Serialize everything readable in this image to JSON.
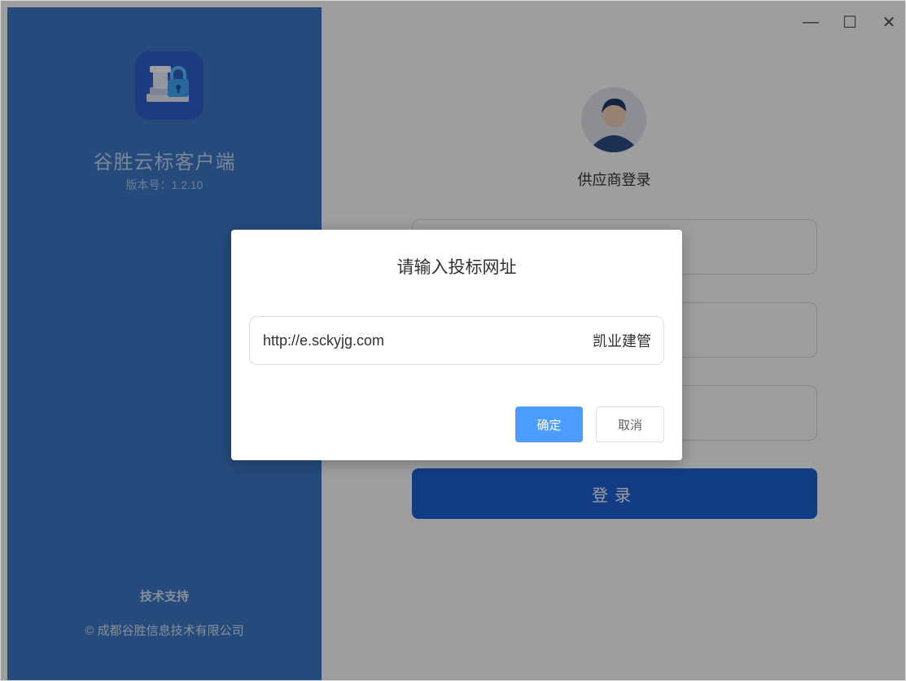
{
  "app": {
    "name": "谷胜云标客户端",
    "version": "版本号：1.2.10",
    "support_title": "技术支持",
    "copyright": "© 成都谷胜信息技术有限公司",
    "logo_icon": "bid-lock-logo-icon"
  },
  "window": {
    "minimize_glyph": "—",
    "maximize_glyph": "☐",
    "close_glyph": "✕"
  },
  "login": {
    "title": "供应商登录",
    "avatar_icon": "user-avatar-icon",
    "button_label": "登录"
  },
  "dialog": {
    "title": "请输入投标网址",
    "url_value": "http://e.sckyjg.com",
    "url_suffix": "凯业建管",
    "confirm_label": "确定",
    "cancel_label": "取消"
  },
  "colors": {
    "brand_panel": "#3d78c8",
    "login_button": "#1e62d6",
    "confirm_button": "#4d9cff"
  }
}
